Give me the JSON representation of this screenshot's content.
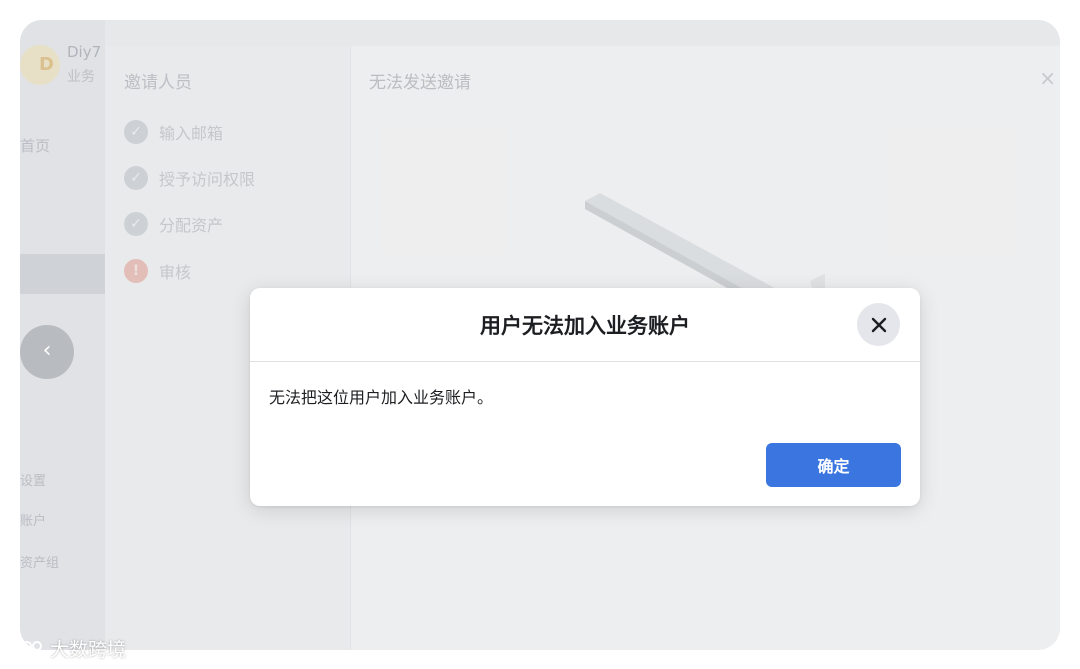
{
  "app": {
    "name": "Diy7",
    "sub": "业务",
    "avatar_letter": "D",
    "sidebar_labels": [
      "首页",
      "设置",
      "账户",
      "资产组"
    ],
    "nav_prev": "‹"
  },
  "wizard": {
    "title": "邀请人员",
    "steps": [
      {
        "label": "输入邮箱",
        "status": "done"
      },
      {
        "label": "授予访问权限",
        "status": "done"
      },
      {
        "label": "分配资产",
        "status": "done"
      },
      {
        "label": "审核",
        "status": "error"
      }
    ],
    "main_title": "无法发送邀请",
    "close_glyph": "×"
  },
  "dialog": {
    "title": "用户无法加入业务账户",
    "message": "无法把这位用户加入业务账户。",
    "confirm_label": "确定",
    "close_icon": "close-icon"
  },
  "watermark": {
    "text": "大数跨境"
  },
  "colors": {
    "primary_button": "#3b76e0",
    "close_bg": "#e4e6eb"
  }
}
